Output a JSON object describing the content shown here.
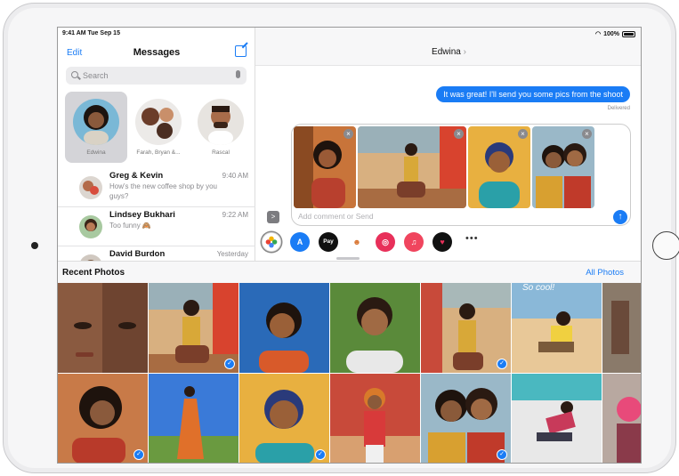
{
  "status": {
    "time": "9:41 AM  Tue Sep 15",
    "battery": "100%"
  },
  "sidebar": {
    "edit": "Edit",
    "title": "Messages",
    "search_placeholder": "Search",
    "pinned": [
      {
        "name": "Edwina"
      },
      {
        "name": "Farah, Bryan &..."
      },
      {
        "name": "Rascal"
      }
    ],
    "conversations": [
      {
        "name": "Greg & Kevin",
        "time": "9:40 AM",
        "preview": "How's the new coffee shop by you guys?"
      },
      {
        "name": "Lindsey Bukhari",
        "time": "9:22 AM",
        "preview": "Too funny 🙈"
      },
      {
        "name": "David Burdon",
        "time": "Yesterday",
        "preview": ""
      }
    ]
  },
  "conversation": {
    "contact": "Edwina",
    "last_message": "It was great! I'll send you some pics from the shoot",
    "delivery_status": "Delivered",
    "compose_placeholder": "Add comment or Send"
  },
  "app_strip": [
    "photos-app",
    "app-store",
    "apple-pay",
    "animoji",
    "images-search",
    "music",
    "heart-sticker"
  ],
  "apple_pay_label": "Pay",
  "more_label": "•••",
  "recent_photos": {
    "title": "Recent Photos",
    "all_label": "All Photos"
  },
  "photo_caption": "So cool!",
  "colors": {
    "accent": "#1a7cf5"
  }
}
